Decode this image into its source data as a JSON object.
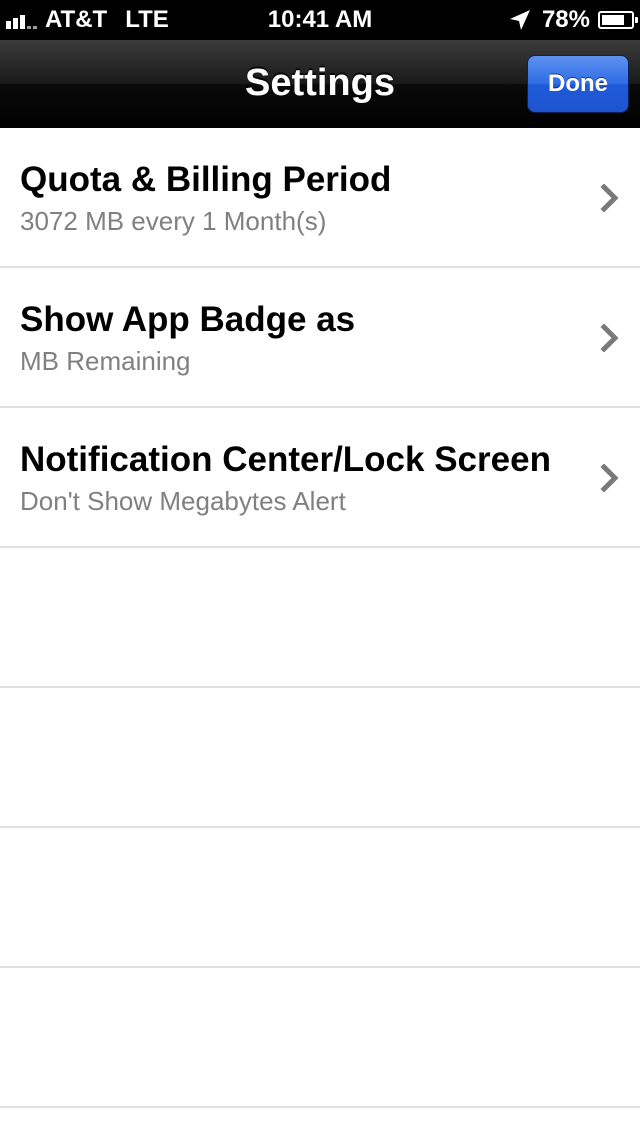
{
  "status_bar": {
    "carrier": "AT&T",
    "network": "LTE",
    "time": "10:41 AM",
    "battery_percent": "78%",
    "battery_level": 0.78,
    "icons": [
      "signal-bars-icon",
      "location-arrow-icon",
      "battery-icon"
    ]
  },
  "nav_bar": {
    "title": "Settings",
    "done_label": "Done",
    "done_color": "#2f6ce5"
  },
  "settings": [
    {
      "title": "Quota & Billing Period",
      "subtitle": "3072 MB every 1 Month(s)",
      "icon": "chevron-right-icon"
    },
    {
      "title": "Show App Badge as",
      "subtitle": "MB Remaining",
      "icon": "chevron-right-icon"
    },
    {
      "title": "Notification Center/Lock Screen",
      "subtitle": "Don't Show Megabytes Alert",
      "icon": "chevron-right-icon"
    }
  ]
}
